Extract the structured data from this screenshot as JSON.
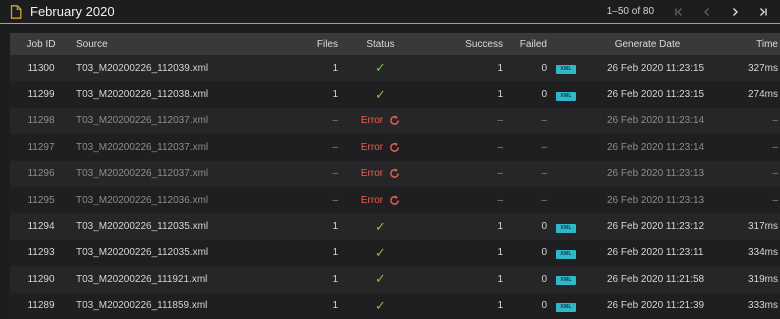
{
  "header": {
    "title": "February 2020",
    "range": "1–50 of 80"
  },
  "columns": {
    "job_id": "Job ID",
    "source": "Source",
    "files": "Files",
    "status": "Status",
    "success": "Success",
    "failed": "Failed",
    "xml": "",
    "generate_date": "Generate Date",
    "time": "Time"
  },
  "rows": [
    {
      "job_id": "11300",
      "source": "T03_M20200226_112039.xml",
      "files": "1",
      "status": "ok",
      "success": "1",
      "failed": "0",
      "xml": "XML",
      "date": "26 Feb 2020 11:23:15",
      "time": "327ms"
    },
    {
      "job_id": "11299",
      "source": "T03_M20200226_112038.xml",
      "files": "1",
      "status": "ok",
      "success": "1",
      "failed": "0",
      "xml": "XML",
      "date": "26 Feb 2020 11:23:15",
      "time": "274ms"
    },
    {
      "job_id": "11298",
      "source": "T03_M20200226_112037.xml",
      "files": "–",
      "status": "Error",
      "success": "–",
      "failed": "–",
      "xml": "",
      "date": "26 Feb 2020 11:23:14",
      "time": "–"
    },
    {
      "job_id": "11297",
      "source": "T03_M20200226_112037.xml",
      "files": "–",
      "status": "Error",
      "success": "–",
      "failed": "–",
      "xml": "",
      "date": "26 Feb 2020 11:23:14",
      "time": "–"
    },
    {
      "job_id": "11296",
      "source": "T03_M20200226_112037.xml",
      "files": "–",
      "status": "Error",
      "success": "–",
      "failed": "–",
      "xml": "",
      "date": "26 Feb 2020 11:23:13",
      "time": "–"
    },
    {
      "job_id": "11295",
      "source": "T03_M20200226_112036.xml",
      "files": "–",
      "status": "Error",
      "success": "–",
      "failed": "–",
      "xml": "",
      "date": "26 Feb 2020 11:23:13",
      "time": "–"
    },
    {
      "job_id": "11294",
      "source": "T03_M20200226_112035.xml",
      "files": "1",
      "status": "ok",
      "success": "1",
      "failed": "0",
      "xml": "XML",
      "date": "26 Feb 2020 11:23:12",
      "time": "317ms"
    },
    {
      "job_id": "11293",
      "source": "T03_M20200226_112035.xml",
      "files": "1",
      "status": "ok",
      "success": "1",
      "failed": "0",
      "xml": "XML",
      "date": "26 Feb 2020 11:23:11",
      "time": "334ms"
    },
    {
      "job_id": "11290",
      "source": "T03_M20200226_111921.xml",
      "files": "1",
      "status": "ok",
      "success": "1",
      "failed": "0",
      "xml": "XML",
      "date": "26 Feb 2020 11:21:58",
      "time": "319ms"
    },
    {
      "job_id": "11289",
      "source": "T03_M20200226_111859.xml",
      "files": "1",
      "status": "ok",
      "success": "1",
      "failed": "0",
      "xml": "XML",
      "date": "26 Feb 2020 11:21:39",
      "time": "333ms"
    }
  ],
  "colors": {
    "accent": "#c9a431",
    "success": "#7fc341",
    "error": "#e8604f",
    "xml_badge": "#2fb8c9"
  },
  "icons": {
    "title": "document-icon",
    "first": "first-page-icon",
    "prev": "chevron-left-icon",
    "next": "chevron-right-icon",
    "last": "last-page-icon",
    "status_ok": "check-icon",
    "status_error": "retry-icon"
  }
}
